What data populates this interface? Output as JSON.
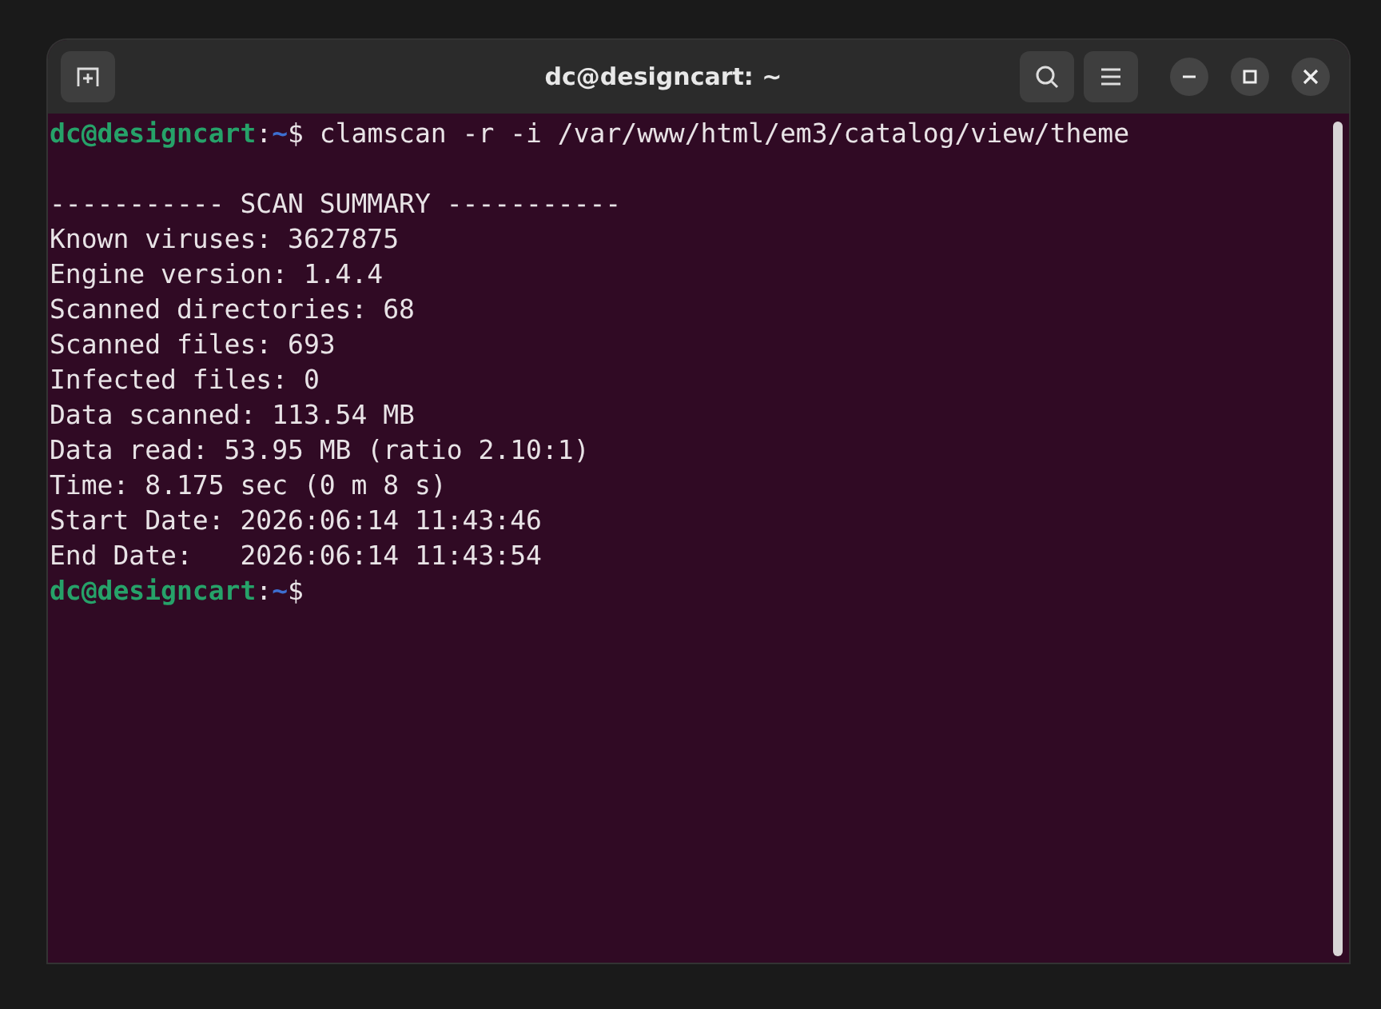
{
  "window": {
    "title": "dc@designcart: ~"
  },
  "terminal": {
    "lines": [
      {
        "kind": "prompt",
        "user": "dc@designcart",
        "separator": ":",
        "path": "~",
        "symbol": "$",
        "command": " clamscan -r -i /var/www/html/em3/catalog/view/theme"
      },
      {
        "kind": "blank"
      },
      {
        "kind": "output",
        "text": "----------- SCAN SUMMARY -----------"
      },
      {
        "kind": "output",
        "text": "Known viruses: 3627875"
      },
      {
        "kind": "output",
        "text": "Engine version: 1.4.4"
      },
      {
        "kind": "output",
        "text": "Scanned directories: 68"
      },
      {
        "kind": "output",
        "text": "Scanned files: 693"
      },
      {
        "kind": "output",
        "text": "Infected files: 0"
      },
      {
        "kind": "output",
        "text": "Data scanned: 113.54 MB"
      },
      {
        "kind": "output",
        "text": "Data read: 53.95 MB (ratio 2.10:1)"
      },
      {
        "kind": "output",
        "text": "Time: 8.175 sec (0 m 8 s)"
      },
      {
        "kind": "output",
        "text": "Start Date: 2026:06:14 11:43:46"
      },
      {
        "kind": "output",
        "text": "End Date:   2026:06:14 11:43:54"
      },
      {
        "kind": "prompt",
        "user": "dc@designcart",
        "separator": ":",
        "path": "~",
        "symbol": "$"
      }
    ]
  }
}
